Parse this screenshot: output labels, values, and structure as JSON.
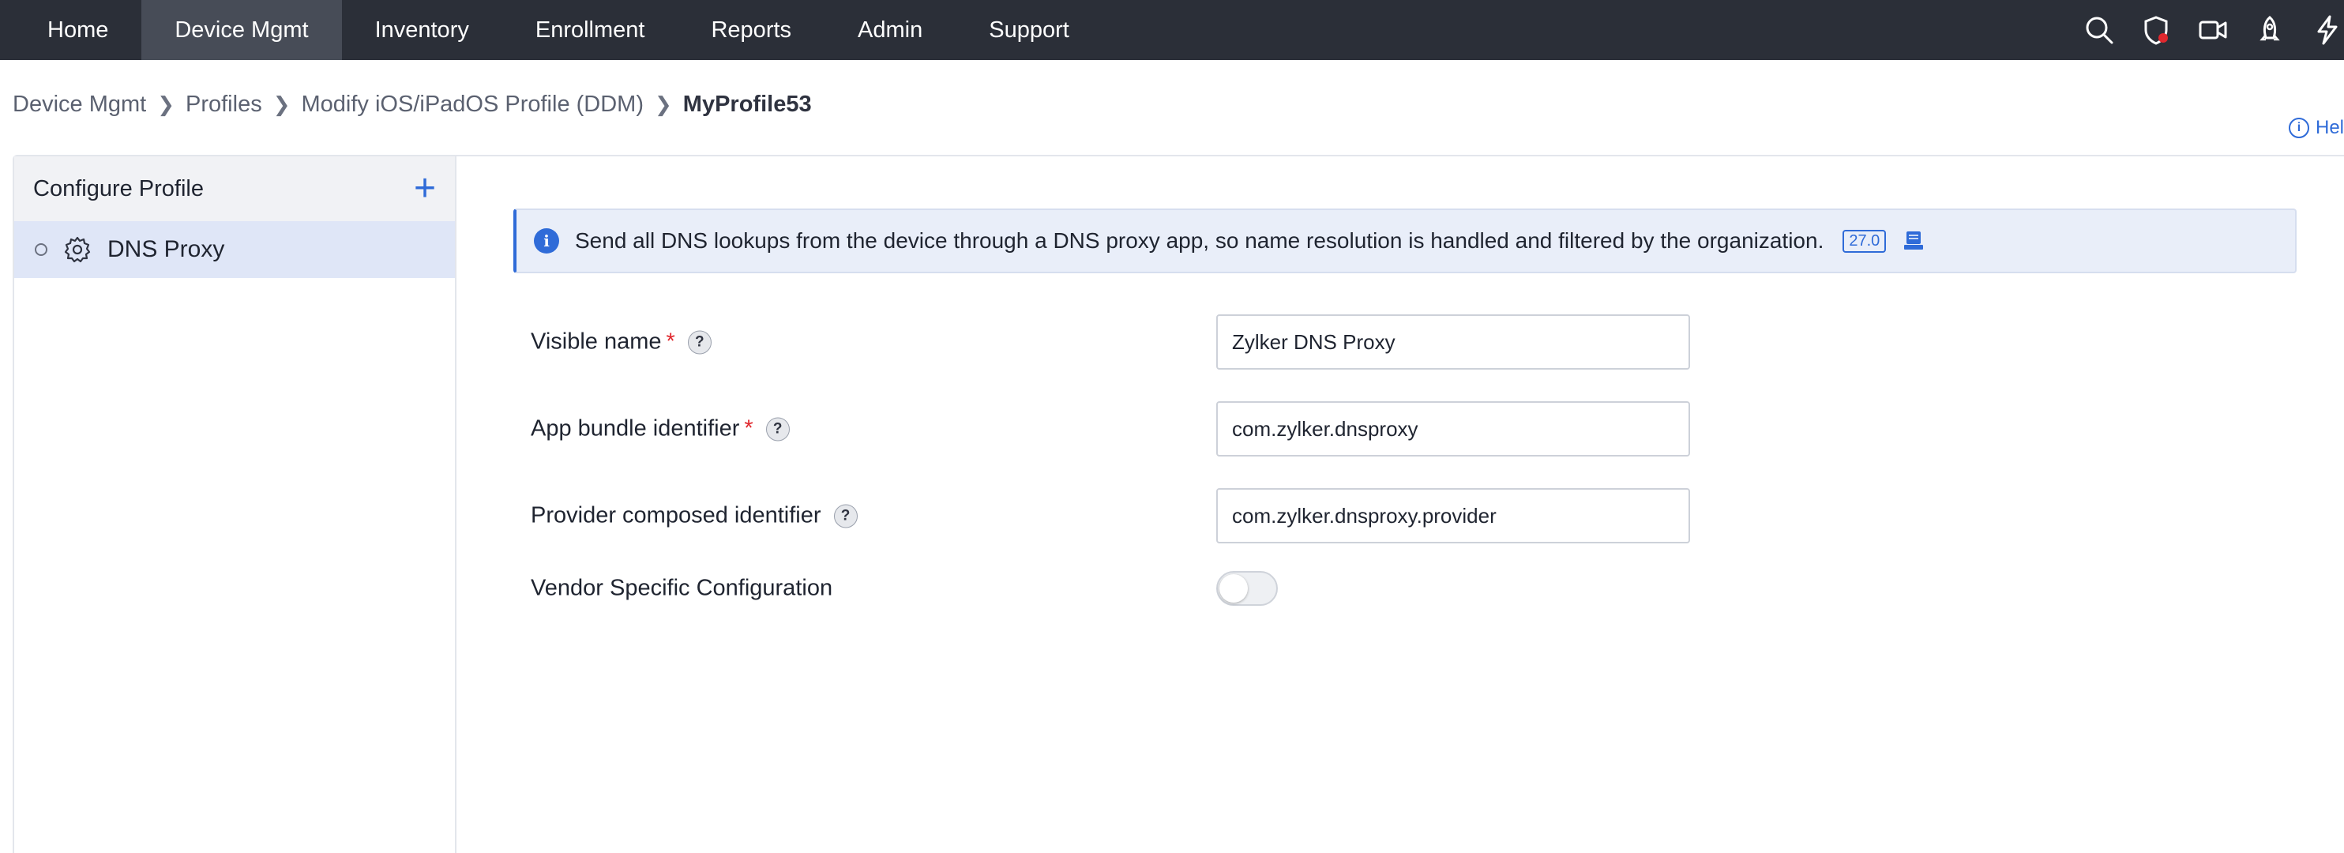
{
  "nav": {
    "tabs": [
      {
        "label": "Home"
      },
      {
        "label": "Device Mgmt",
        "active": true
      },
      {
        "label": "Inventory"
      },
      {
        "label": "Enrollment"
      },
      {
        "label": "Reports"
      },
      {
        "label": "Admin"
      },
      {
        "label": "Support"
      }
    ],
    "right_icons": [
      "search-icon",
      "shield-alert-icon",
      "video-icon",
      "rocket-icon",
      "lightning-icon"
    ]
  },
  "breadcrumb": {
    "items": [
      "Device Mgmt",
      "Profiles",
      "Modify iOS/iPadOS Profile (DDM)"
    ],
    "current": "MyProfile53"
  },
  "help": {
    "label": "Hel"
  },
  "sidebar": {
    "title": "Configure Profile",
    "items": [
      {
        "label": "DNS Proxy",
        "icon": "gear-icon"
      }
    ]
  },
  "banner": {
    "text": "Send all DNS lookups from the device through a DNS proxy app, so name resolution is handled and filtered by the organization.",
    "version": "27.0"
  },
  "form": {
    "visible_name": {
      "label": "Visible name",
      "required": "*",
      "value": "Zylker DNS Proxy"
    },
    "app_bundle": {
      "label": "App bundle identifier",
      "required": "*",
      "value": "com.zylker.dnsproxy"
    },
    "provider": {
      "label": "Provider composed identifier",
      "value": "com.zylker.dnsproxy.provider"
    },
    "vendor": {
      "label": "Vendor Specific Configuration",
      "enabled": false
    }
  },
  "help_glyph": "?",
  "colors": {
    "nav_bg": "#2b2f38",
    "nav_active": "#474c57",
    "accent": "#2f6bd8",
    "required": "#e0282e",
    "selected_row": "#dfe6f7"
  }
}
